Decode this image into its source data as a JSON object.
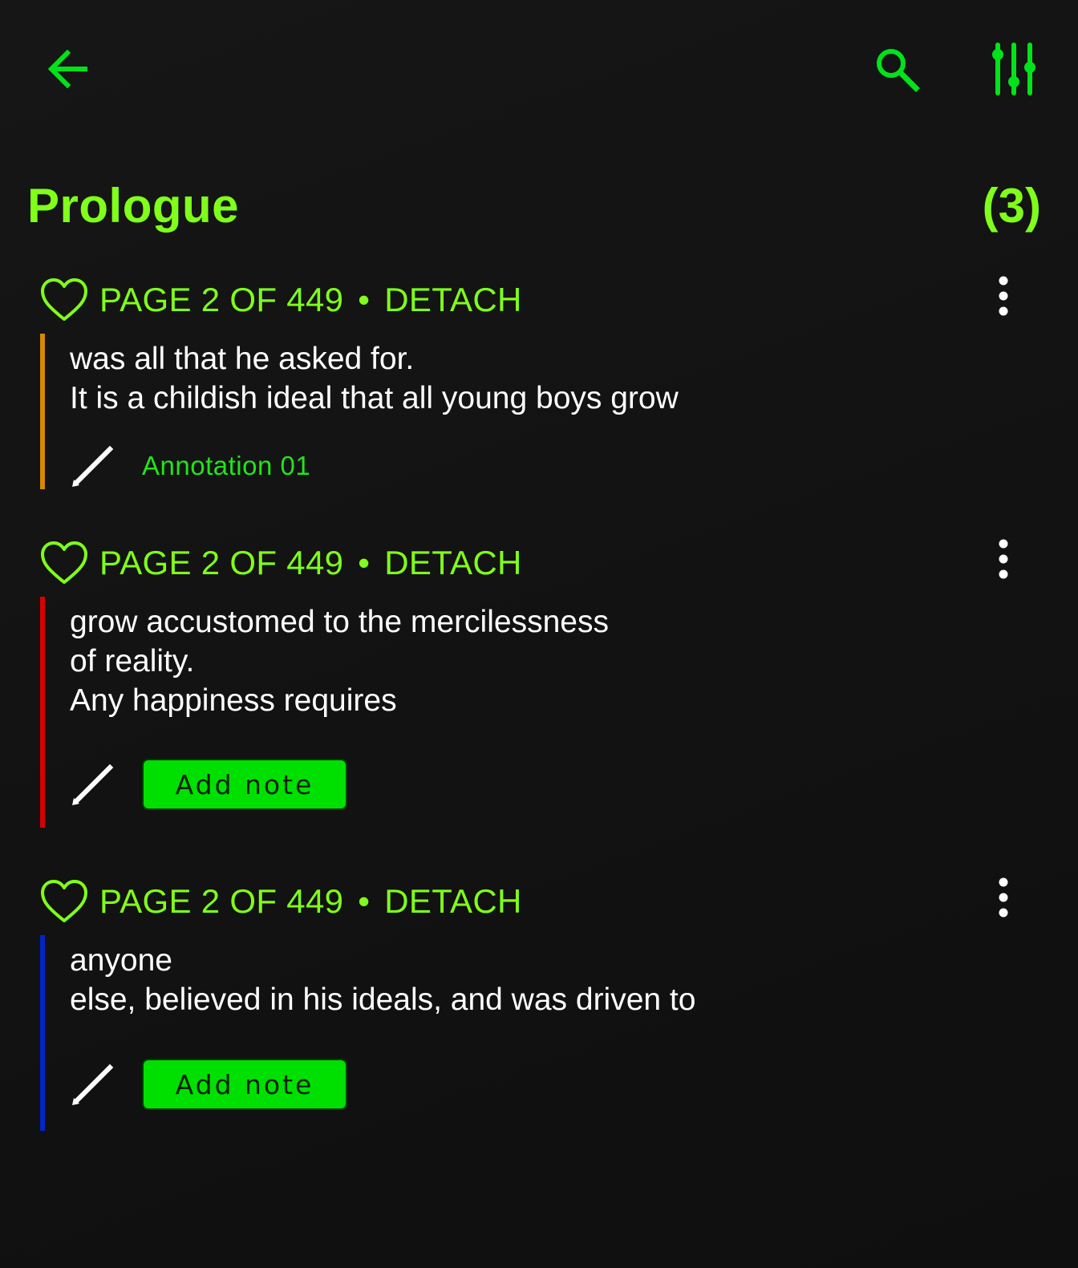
{
  "header": {
    "back_icon": "arrow-left-icon",
    "search_icon": "search-icon",
    "filter_icon": "sliders-icon",
    "accent_color": "#00e31a"
  },
  "section": {
    "title": "Prologue",
    "count": "(3)"
  },
  "highlights": [
    {
      "page": "PAGE 2 OF 449",
      "separator": "•",
      "action": "DETACH",
      "text": "was all that he asked for.\nIt is a childish ideal that all young boys grow",
      "color": "#d58a00",
      "note": "Annotation 01",
      "note_button": null
    },
    {
      "page": "PAGE 2 OF 449",
      "separator": "•",
      "action": "DETACH",
      "text": "grow accustomed to the mercilessness\nof reality.\nAny happiness requires",
      "color": "#d80000",
      "note": null,
      "note_button": "Add note"
    },
    {
      "page": "PAGE 2 OF 449",
      "separator": "•",
      "action": "DETACH",
      "text": "anyone\nelse, believed in his ideals, and was driven to",
      "color": "#0026c8",
      "note": null,
      "note_button": "Add note"
    }
  ]
}
